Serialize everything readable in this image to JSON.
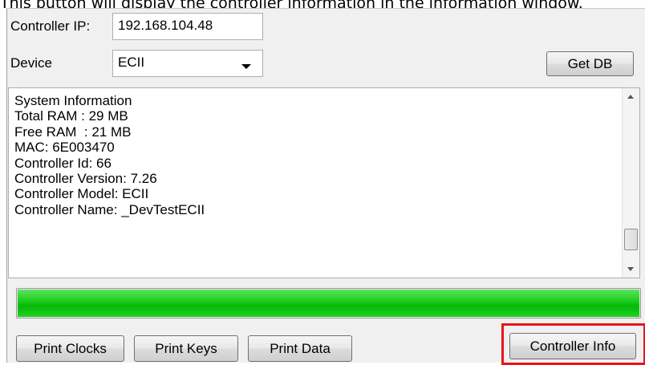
{
  "caption": "This button will display the controller information in the information window.",
  "form": {
    "ip_label": "Controller IP:",
    "ip_value": "192.168.104.48",
    "device_label": "Device",
    "device_value": "ECII",
    "get_db_label": "Get DB"
  },
  "info": {
    "lines": [
      "System Information",
      "Total RAM : 29 MB",
      "Free RAM  : 21 MB",
      "MAC: 6E003470",
      "Controller Id: 66",
      "Controller Version: 7.26",
      "Controller Model: ECII",
      "Controller Name: _DevTestECII"
    ]
  },
  "progress": {
    "value_percent": 100,
    "color": "#06b906"
  },
  "buttons": {
    "print_clocks": "Print Clocks",
    "print_keys": "Print Keys",
    "print_data": "Print Data",
    "controller_info": "Controller Info"
  },
  "icons": {
    "dropdown": "chevron-down-icon",
    "scroll_up": "scroll-up-arrow-icon",
    "scroll_down": "scroll-down-arrow-icon"
  },
  "colors": {
    "highlight": "#e8141b"
  }
}
